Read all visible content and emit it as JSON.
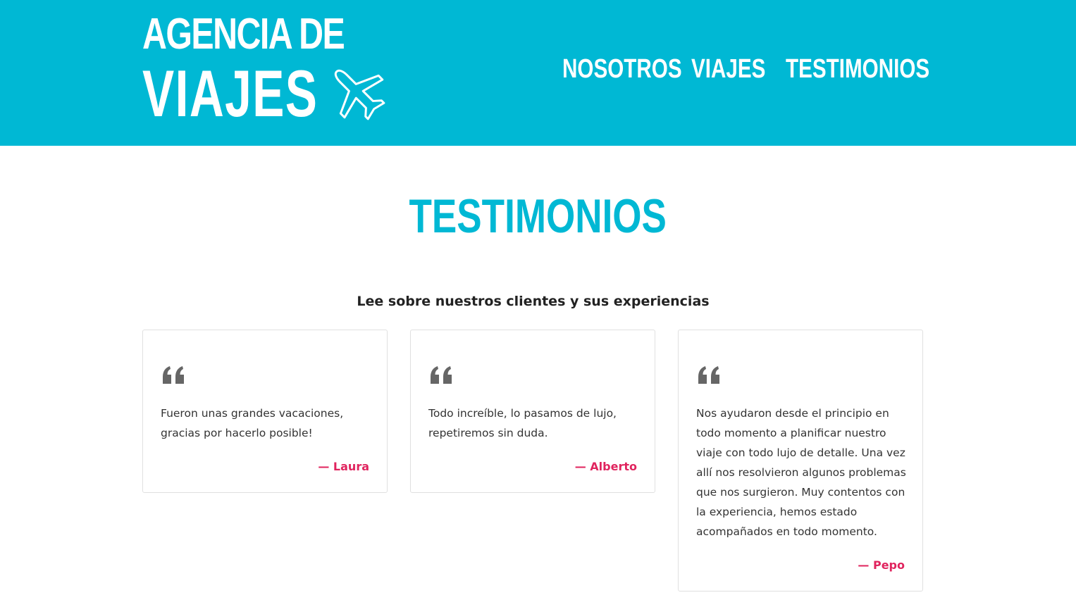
{
  "header": {
    "logo_line1": "AGENCIA DE",
    "logo_line2": "VIAJES",
    "nav": [
      {
        "label": "NOSOTROS"
      },
      {
        "label": "VIAJES"
      },
      {
        "label": "TESTIMONIOS"
      }
    ]
  },
  "main": {
    "title": "TESTIMONIOS",
    "subtitle": "Lee sobre nuestros clientes y sus experiencias",
    "testimonials": [
      {
        "text": "Fueron unas grandes vacaciones, gracias por hacerlo posible!",
        "author": "— Laura"
      },
      {
        "text": "Todo increíble, lo pasamos de lujo, repetiremos sin duda.",
        "author": "— Alberto"
      },
      {
        "text": "Nos ayudaron desde el principio en todo momento a planificar nuestro viaje con todo lujo de detalle. Una vez allí nos resolvieron algunos problemas que nos surgieron. Muy contentos con la experiencia, hemos estado acompañados en todo momento.",
        "author": "— Pepo"
      }
    ]
  },
  "colors": {
    "brand": "#00b8d4",
    "author": "#e0245e",
    "quote_icon": "#666666"
  },
  "icons": {
    "logo_icon": "airplane-icon",
    "quote_icon": "quote-open-icon"
  }
}
